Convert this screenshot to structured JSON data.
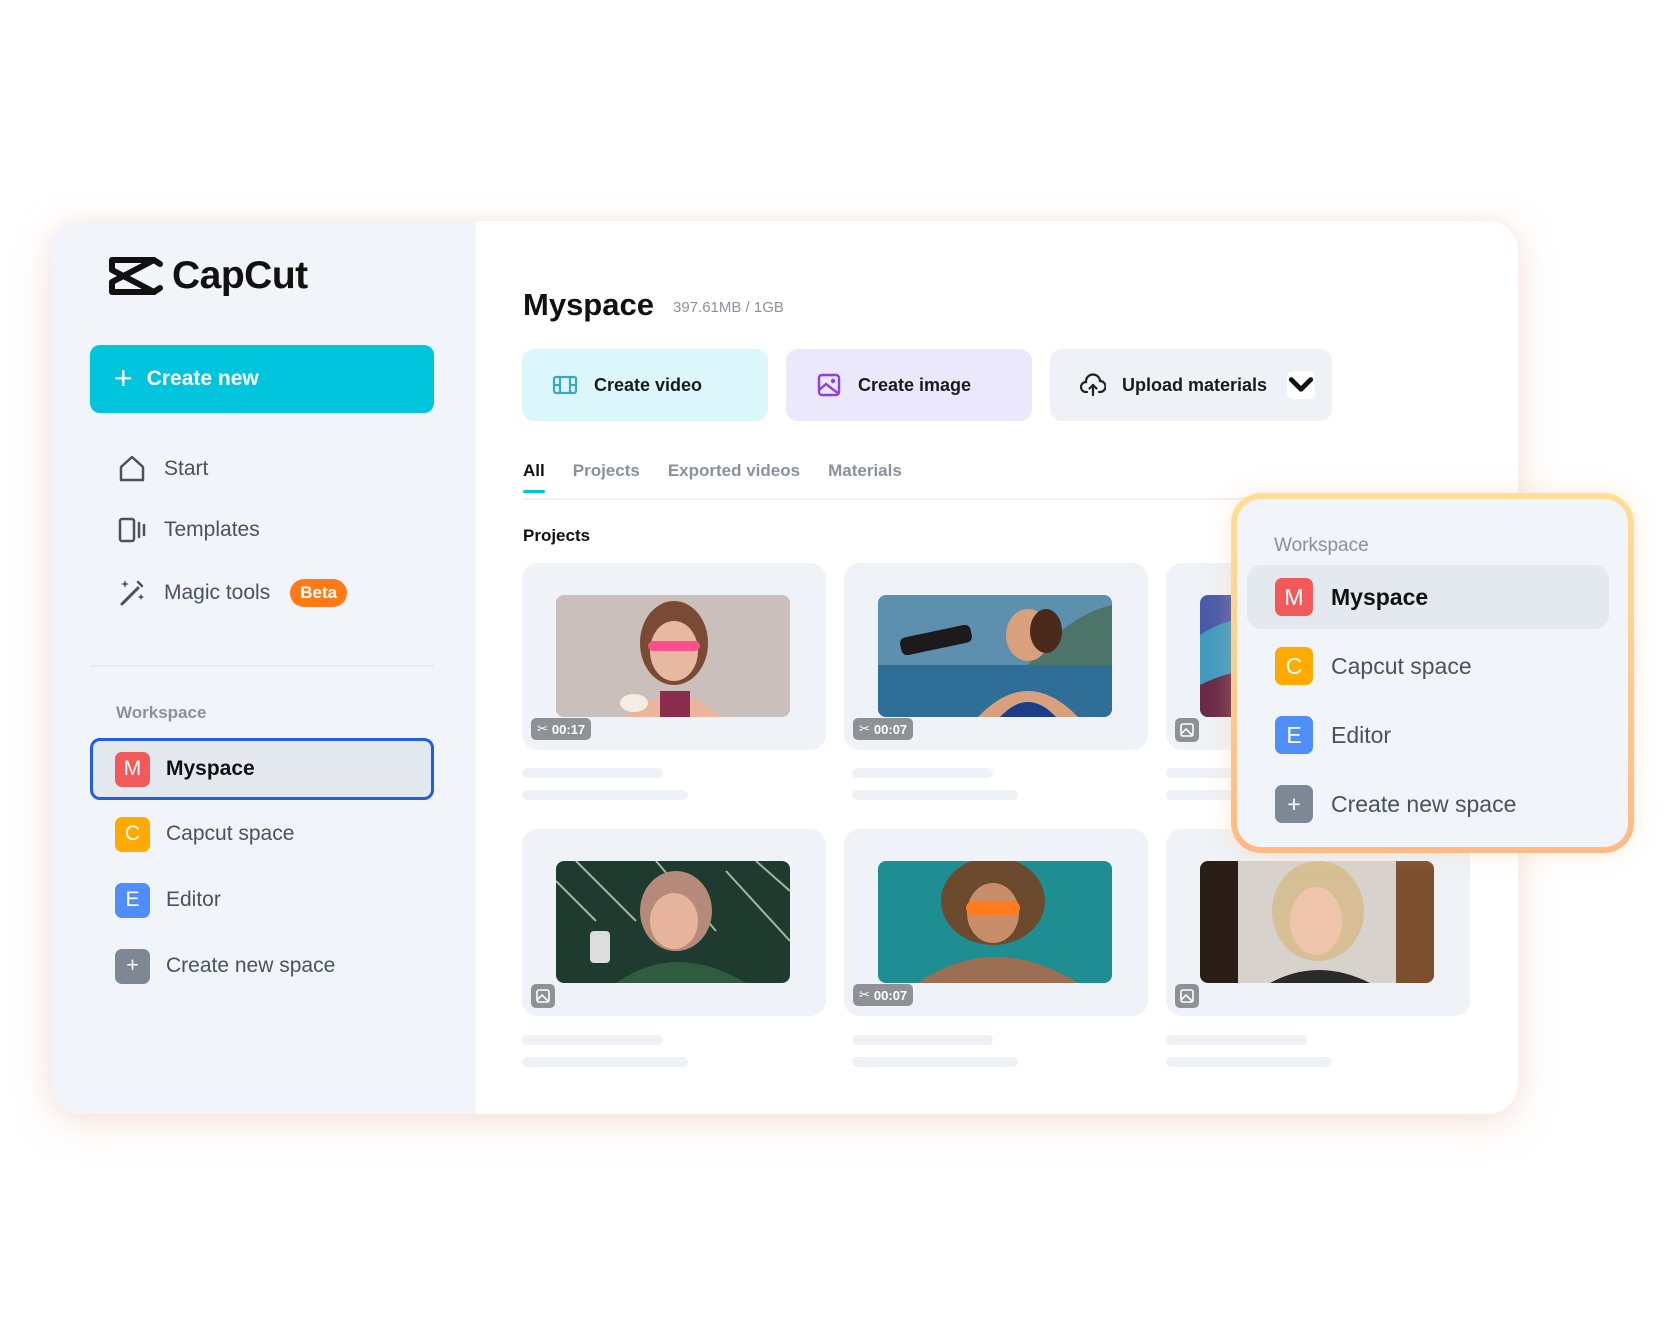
{
  "app": {
    "name": "CapCut"
  },
  "sidebar": {
    "create_new_label": "Create new",
    "nav": [
      {
        "label": "Start",
        "icon": "home-icon"
      },
      {
        "label": "Templates",
        "icon": "templates-icon"
      },
      {
        "label": "Magic tools",
        "icon": "magic-wand-icon",
        "badge": "Beta"
      }
    ],
    "workspace_label": "Workspace",
    "workspaces": [
      {
        "letter": "M",
        "label": "Myspace",
        "color": "#f25a5a",
        "active": true
      },
      {
        "letter": "C",
        "label": "Capcut space",
        "color": "#ffaa00",
        "active": false
      },
      {
        "letter": "E",
        "label": "Editor",
        "color": "#4f8ef7",
        "active": false
      },
      {
        "letter": "+",
        "label": "Create new space",
        "color": "#7e8794",
        "active": false
      }
    ]
  },
  "main": {
    "title": "Myspace",
    "storage": "397.61MB / 1GB",
    "actions": [
      {
        "label": "Create video",
        "icon": "film-icon",
        "icon_color": "#3aa8c1"
      },
      {
        "label": "Create image",
        "icon": "image-icon",
        "icon_color": "#8a3ff0"
      },
      {
        "label": "Upload materials",
        "icon": "cloud-upload-icon"
      }
    ],
    "tabs": [
      {
        "label": "All",
        "active": true
      },
      {
        "label": "Projects",
        "active": false
      },
      {
        "label": "Exported videos",
        "active": false
      },
      {
        "label": "Materials",
        "active": false
      }
    ],
    "section_title": "Projects",
    "projects": [
      {
        "type": "video",
        "duration": "00:17",
        "thumbnail": "woman-pink-glasses-cupcake"
      },
      {
        "type": "video",
        "duration": "00:07",
        "thumbnail": "woman-drinking-water-bottle"
      },
      {
        "type": "image",
        "duration": "",
        "thumbnail": "abstract-colorful-art"
      },
      {
        "type": "image",
        "duration": "",
        "thumbnail": "woman-headphones-phone"
      },
      {
        "type": "video",
        "duration": "00:07",
        "thumbnail": "woman-orange-glasses-earphones"
      },
      {
        "type": "image",
        "duration": "",
        "thumbnail": "blonde-girl-portrait"
      }
    ]
  },
  "popup": {
    "workspace_label": "Workspace",
    "items": [
      {
        "letter": "M",
        "label": "Myspace",
        "color": "#f25a5a",
        "active": true
      },
      {
        "letter": "C",
        "label": "Capcut space",
        "color": "#ffaa00",
        "active": false
      },
      {
        "letter": "E",
        "label": "Editor",
        "color": "#4f8ef7",
        "active": false
      },
      {
        "letter": "+",
        "label": "Create new space",
        "color": "#7e8794",
        "active": false
      }
    ]
  }
}
